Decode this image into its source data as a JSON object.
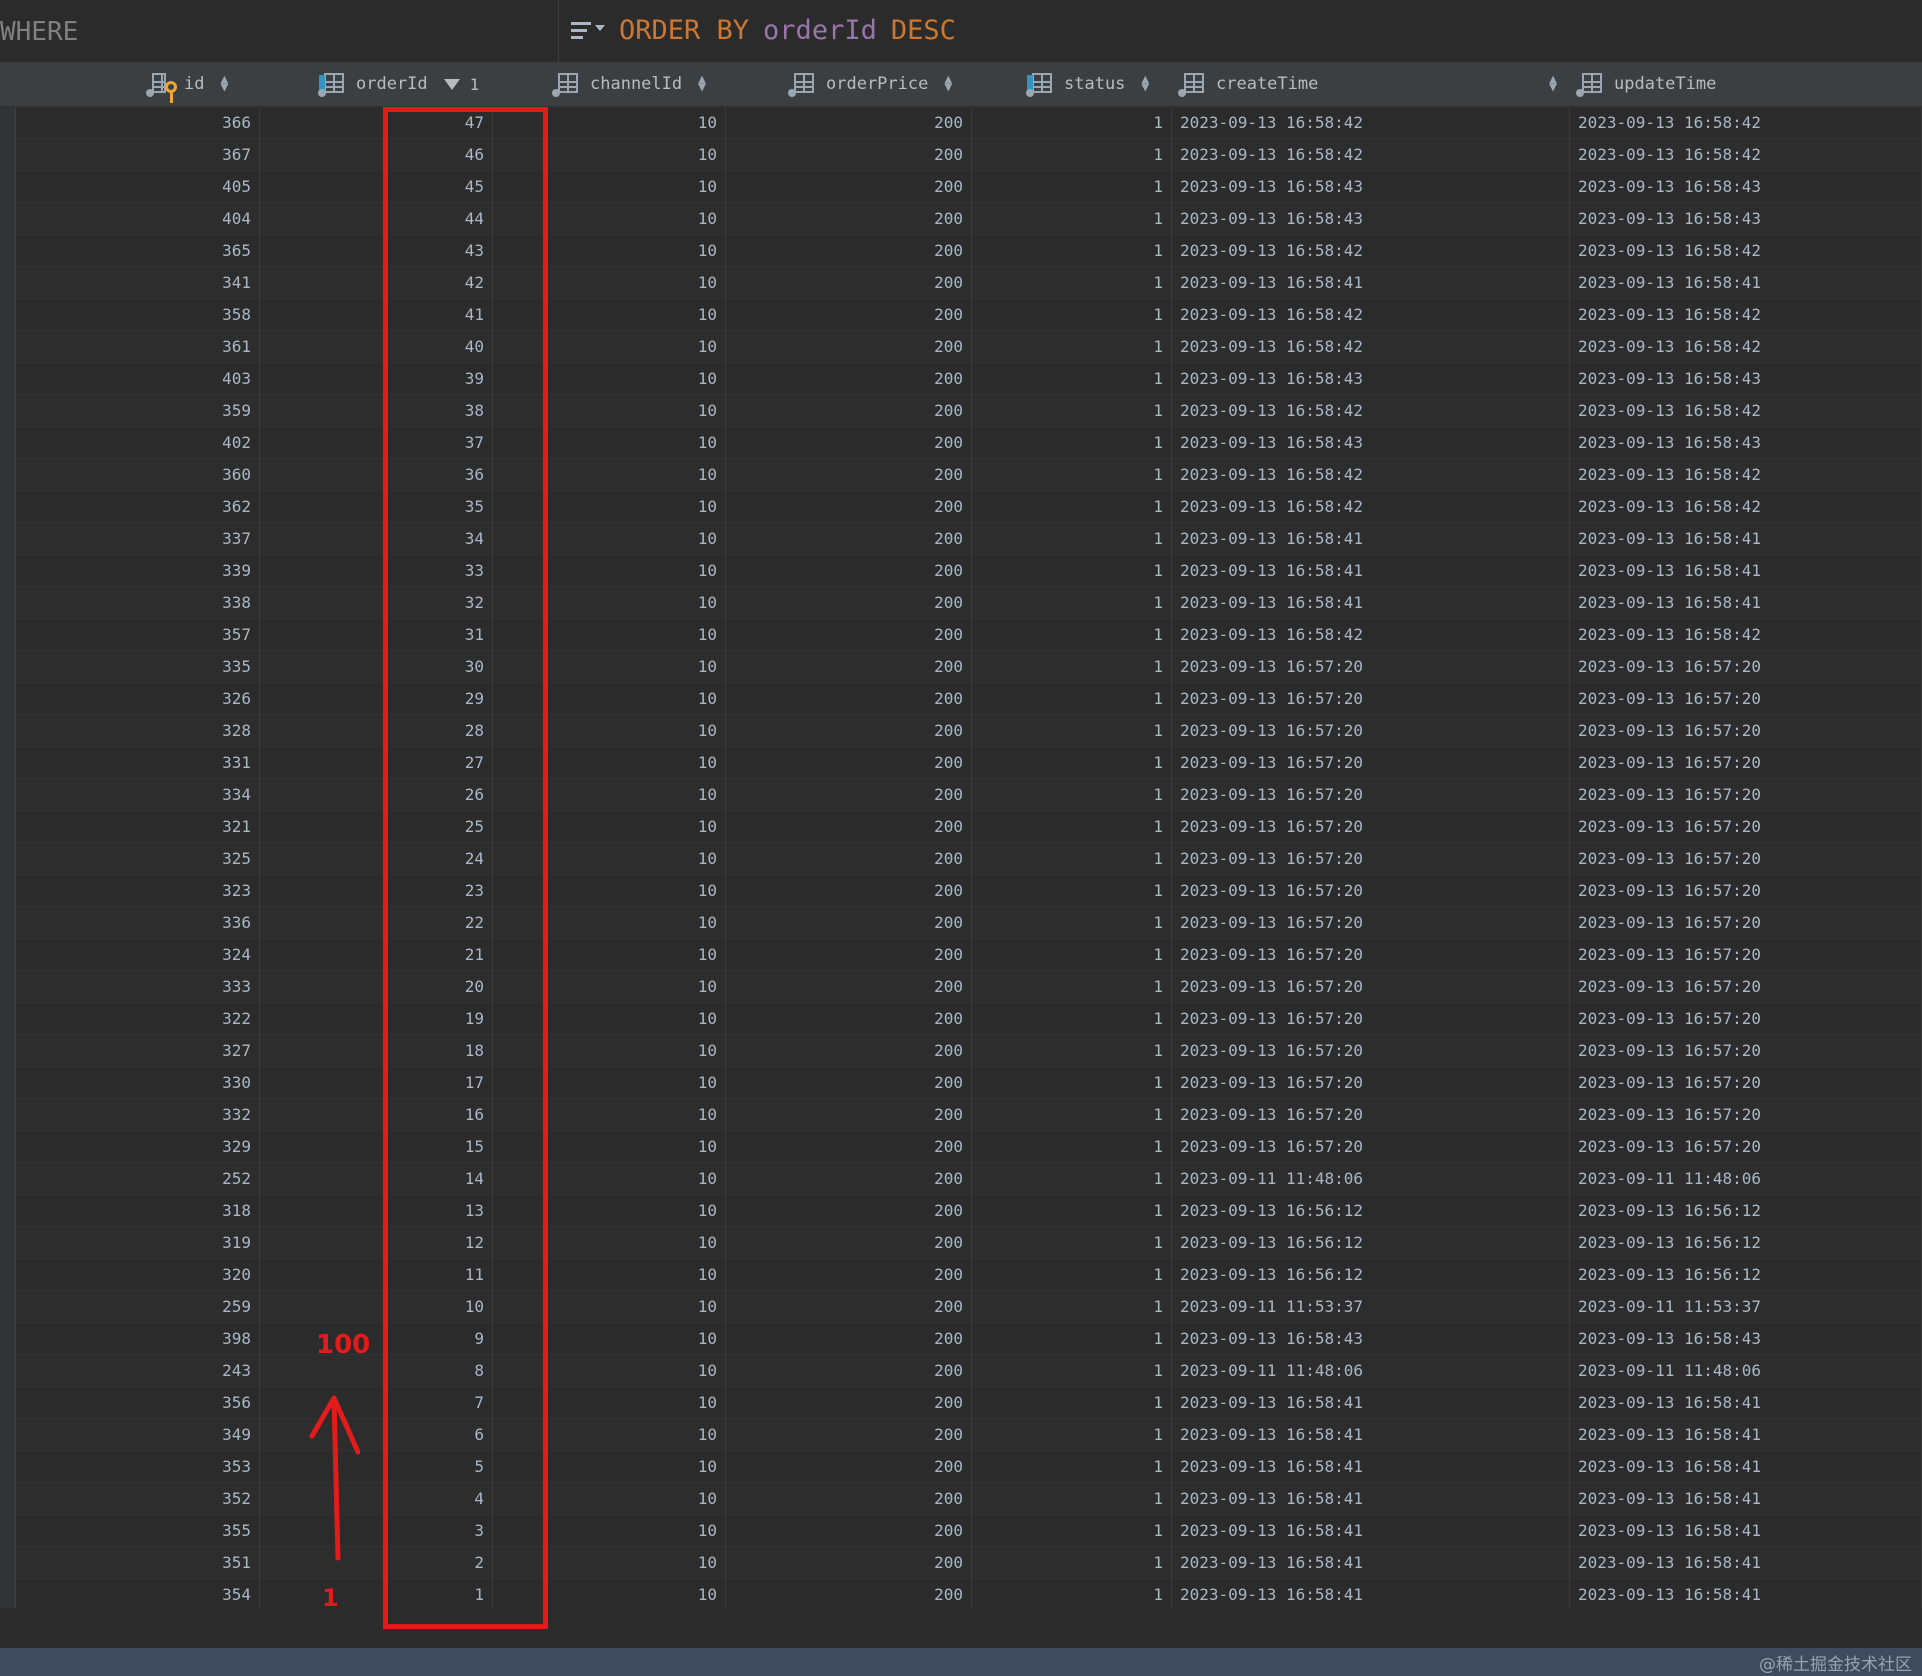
{
  "filter": {
    "where_label": "WHERE",
    "order_by_keyword": "ORDER BY",
    "order_by_column": "orderId",
    "order_by_direction": "DESC"
  },
  "columns": [
    {
      "name": "id",
      "icon": "primary-key-column-icon",
      "sort": "none"
    },
    {
      "name": "orderId",
      "icon": "column-icon",
      "sort": "desc",
      "sort_index": "1"
    },
    {
      "name": "channelId",
      "icon": "column-icon",
      "sort": "none"
    },
    {
      "name": "orderPrice",
      "icon": "column-icon",
      "sort": "none"
    },
    {
      "name": "status",
      "icon": "column-icon",
      "sort": "none"
    },
    {
      "name": "createTime",
      "icon": "column-icon",
      "sort": "none"
    },
    {
      "name": "updateTime",
      "icon": "column-icon",
      "sort": "none"
    }
  ],
  "rows": [
    [
      "366",
      "47",
      "10",
      "200",
      "1",
      "2023-09-13 16:58:42",
      "2023-09-13 16:58:42"
    ],
    [
      "367",
      "46",
      "10",
      "200",
      "1",
      "2023-09-13 16:58:42",
      "2023-09-13 16:58:42"
    ],
    [
      "405",
      "45",
      "10",
      "200",
      "1",
      "2023-09-13 16:58:43",
      "2023-09-13 16:58:43"
    ],
    [
      "404",
      "44",
      "10",
      "200",
      "1",
      "2023-09-13 16:58:43",
      "2023-09-13 16:58:43"
    ],
    [
      "365",
      "43",
      "10",
      "200",
      "1",
      "2023-09-13 16:58:42",
      "2023-09-13 16:58:42"
    ],
    [
      "341",
      "42",
      "10",
      "200",
      "1",
      "2023-09-13 16:58:41",
      "2023-09-13 16:58:41"
    ],
    [
      "358",
      "41",
      "10",
      "200",
      "1",
      "2023-09-13 16:58:42",
      "2023-09-13 16:58:42"
    ],
    [
      "361",
      "40",
      "10",
      "200",
      "1",
      "2023-09-13 16:58:42",
      "2023-09-13 16:58:42"
    ],
    [
      "403",
      "39",
      "10",
      "200",
      "1",
      "2023-09-13 16:58:43",
      "2023-09-13 16:58:43"
    ],
    [
      "359",
      "38",
      "10",
      "200",
      "1",
      "2023-09-13 16:58:42",
      "2023-09-13 16:58:42"
    ],
    [
      "402",
      "37",
      "10",
      "200",
      "1",
      "2023-09-13 16:58:43",
      "2023-09-13 16:58:43"
    ],
    [
      "360",
      "36",
      "10",
      "200",
      "1",
      "2023-09-13 16:58:42",
      "2023-09-13 16:58:42"
    ],
    [
      "362",
      "35",
      "10",
      "200",
      "1",
      "2023-09-13 16:58:42",
      "2023-09-13 16:58:42"
    ],
    [
      "337",
      "34",
      "10",
      "200",
      "1",
      "2023-09-13 16:58:41",
      "2023-09-13 16:58:41"
    ],
    [
      "339",
      "33",
      "10",
      "200",
      "1",
      "2023-09-13 16:58:41",
      "2023-09-13 16:58:41"
    ],
    [
      "338",
      "32",
      "10",
      "200",
      "1",
      "2023-09-13 16:58:41",
      "2023-09-13 16:58:41"
    ],
    [
      "357",
      "31",
      "10",
      "200",
      "1",
      "2023-09-13 16:58:42",
      "2023-09-13 16:58:42"
    ],
    [
      "335",
      "30",
      "10",
      "200",
      "1",
      "2023-09-13 16:57:20",
      "2023-09-13 16:57:20"
    ],
    [
      "326",
      "29",
      "10",
      "200",
      "1",
      "2023-09-13 16:57:20",
      "2023-09-13 16:57:20"
    ],
    [
      "328",
      "28",
      "10",
      "200",
      "1",
      "2023-09-13 16:57:20",
      "2023-09-13 16:57:20"
    ],
    [
      "331",
      "27",
      "10",
      "200",
      "1",
      "2023-09-13 16:57:20",
      "2023-09-13 16:57:20"
    ],
    [
      "334",
      "26",
      "10",
      "200",
      "1",
      "2023-09-13 16:57:20",
      "2023-09-13 16:57:20"
    ],
    [
      "321",
      "25",
      "10",
      "200",
      "1",
      "2023-09-13 16:57:20",
      "2023-09-13 16:57:20"
    ],
    [
      "325",
      "24",
      "10",
      "200",
      "1",
      "2023-09-13 16:57:20",
      "2023-09-13 16:57:20"
    ],
    [
      "323",
      "23",
      "10",
      "200",
      "1",
      "2023-09-13 16:57:20",
      "2023-09-13 16:57:20"
    ],
    [
      "336",
      "22",
      "10",
      "200",
      "1",
      "2023-09-13 16:57:20",
      "2023-09-13 16:57:20"
    ],
    [
      "324",
      "21",
      "10",
      "200",
      "1",
      "2023-09-13 16:57:20",
      "2023-09-13 16:57:20"
    ],
    [
      "333",
      "20",
      "10",
      "200",
      "1",
      "2023-09-13 16:57:20",
      "2023-09-13 16:57:20"
    ],
    [
      "322",
      "19",
      "10",
      "200",
      "1",
      "2023-09-13 16:57:20",
      "2023-09-13 16:57:20"
    ],
    [
      "327",
      "18",
      "10",
      "200",
      "1",
      "2023-09-13 16:57:20",
      "2023-09-13 16:57:20"
    ],
    [
      "330",
      "17",
      "10",
      "200",
      "1",
      "2023-09-13 16:57:20",
      "2023-09-13 16:57:20"
    ],
    [
      "332",
      "16",
      "10",
      "200",
      "1",
      "2023-09-13 16:57:20",
      "2023-09-13 16:57:20"
    ],
    [
      "329",
      "15",
      "10",
      "200",
      "1",
      "2023-09-13 16:57:20",
      "2023-09-13 16:57:20"
    ],
    [
      "252",
      "14",
      "10",
      "200",
      "1",
      "2023-09-11 11:48:06",
      "2023-09-11 11:48:06"
    ],
    [
      "318",
      "13",
      "10",
      "200",
      "1",
      "2023-09-13 16:56:12",
      "2023-09-13 16:56:12"
    ],
    [
      "319",
      "12",
      "10",
      "200",
      "1",
      "2023-09-13 16:56:12",
      "2023-09-13 16:56:12"
    ],
    [
      "320",
      "11",
      "10",
      "200",
      "1",
      "2023-09-13 16:56:12",
      "2023-09-13 16:56:12"
    ],
    [
      "259",
      "10",
      "10",
      "200",
      "1",
      "2023-09-11 11:53:37",
      "2023-09-11 11:53:37"
    ],
    [
      "398",
      "9",
      "10",
      "200",
      "1",
      "2023-09-13 16:58:43",
      "2023-09-13 16:58:43"
    ],
    [
      "243",
      "8",
      "10",
      "200",
      "1",
      "2023-09-11 11:48:06",
      "2023-09-11 11:48:06"
    ],
    [
      "356",
      "7",
      "10",
      "200",
      "1",
      "2023-09-13 16:58:41",
      "2023-09-13 16:58:41"
    ],
    [
      "349",
      "6",
      "10",
      "200",
      "1",
      "2023-09-13 16:58:41",
      "2023-09-13 16:58:41"
    ],
    [
      "353",
      "5",
      "10",
      "200",
      "1",
      "2023-09-13 16:58:41",
      "2023-09-13 16:58:41"
    ],
    [
      "352",
      "4",
      "10",
      "200",
      "1",
      "2023-09-13 16:58:41",
      "2023-09-13 16:58:41"
    ],
    [
      "355",
      "3",
      "10",
      "200",
      "1",
      "2023-09-13 16:58:41",
      "2023-09-13 16:58:41"
    ],
    [
      "351",
      "2",
      "10",
      "200",
      "1",
      "2023-09-13 16:58:41",
      "2023-09-13 16:58:41"
    ],
    [
      "354",
      "1",
      "10",
      "200",
      "1",
      "2023-09-13 16:58:41",
      "2023-09-13 16:58:41"
    ]
  ],
  "annotation": {
    "top_label": "100",
    "bottom_label": "1",
    "color": "#e31b1b"
  },
  "watermark": "@稀土掘金技术社区",
  "colors": {
    "background": "#2b2b2b",
    "header_background": "#3c3f41",
    "keyword": "#cc7832",
    "column_ref": "#9876aa",
    "cell_text": "#a9b7c6"
  }
}
